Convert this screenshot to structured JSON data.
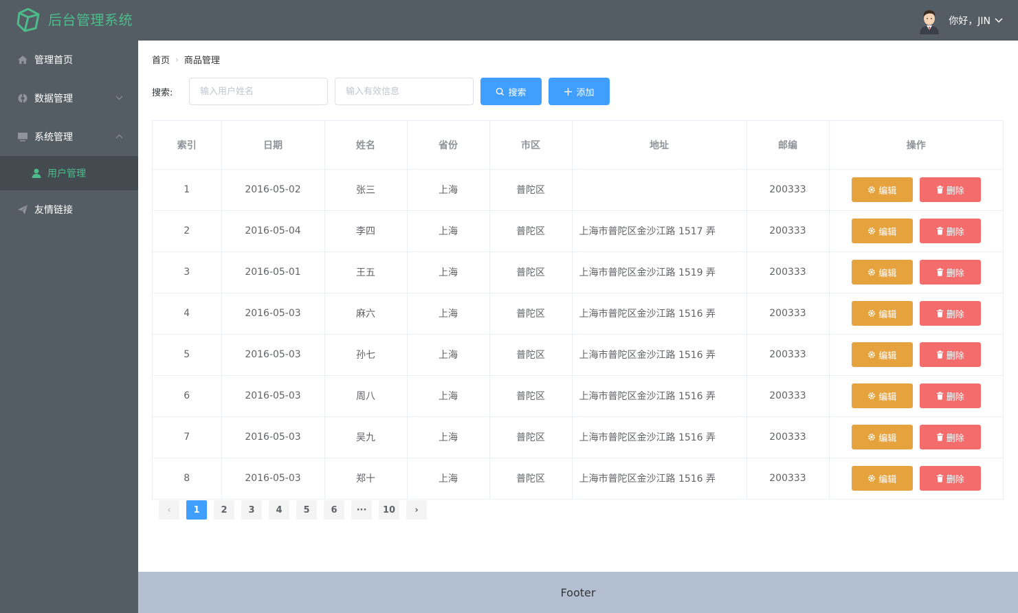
{
  "header": {
    "title": "后台管理系统",
    "greeting": "你好，JIN"
  },
  "sidebar": {
    "items": [
      {
        "label": "管理首页",
        "icon": "home-icon"
      },
      {
        "label": "数据管理",
        "icon": "data-icon"
      },
      {
        "label": "系统管理",
        "icon": "monitor-icon"
      },
      {
        "label": "用户管理",
        "icon": "user-icon"
      },
      {
        "label": "友情链接",
        "icon": "send-icon"
      }
    ]
  },
  "breadcrumb": {
    "home": "首页",
    "current": "商品管理"
  },
  "search": {
    "label": "搜索:",
    "name_placeholder": "输入用户姓名",
    "info_placeholder": "输入有效信息",
    "search_label": "搜索",
    "add_label": "添加"
  },
  "table": {
    "columns": [
      "索引",
      "日期",
      "姓名",
      "省份",
      "市区",
      "地址",
      "邮编",
      "操作"
    ],
    "edit_label": "编辑",
    "delete_label": "删除",
    "rows": [
      {
        "index": "1",
        "date": "2016-05-02",
        "name": "张三",
        "province": "上海",
        "city": "普陀区",
        "address": "",
        "zip": "200333"
      },
      {
        "index": "2",
        "date": "2016-05-04",
        "name": "李四",
        "province": "上海",
        "city": "普陀区",
        "address": "上海市普陀区金沙江路 1517 弄",
        "zip": "200333"
      },
      {
        "index": "3",
        "date": "2016-05-01",
        "name": "王五",
        "province": "上海",
        "city": "普陀区",
        "address": "上海市普陀区金沙江路 1519 弄",
        "zip": "200333"
      },
      {
        "index": "4",
        "date": "2016-05-03",
        "name": "麻六",
        "province": "上海",
        "city": "普陀区",
        "address": "上海市普陀区金沙江路 1516 弄",
        "zip": "200333"
      },
      {
        "index": "5",
        "date": "2016-05-03",
        "name": "孙七",
        "province": "上海",
        "city": "普陀区",
        "address": "上海市普陀区金沙江路 1516 弄",
        "zip": "200333"
      },
      {
        "index": "6",
        "date": "2016-05-03",
        "name": "周八",
        "province": "上海",
        "city": "普陀区",
        "address": "上海市普陀区金沙江路 1516 弄",
        "zip": "200333"
      },
      {
        "index": "7",
        "date": "2016-05-03",
        "name": "吴九",
        "province": "上海",
        "city": "普陀区",
        "address": "上海市普陀区金沙江路 1516 弄",
        "zip": "200333"
      },
      {
        "index": "8",
        "date": "2016-05-03",
        "name": "郑十",
        "province": "上海",
        "city": "普陀区",
        "address": "上海市普陀区金沙江路 1516 弄",
        "zip": "200333"
      }
    ]
  },
  "pagination": {
    "pages": [
      "1",
      "2",
      "3",
      "4",
      "5",
      "6",
      "···",
      "10"
    ],
    "current": "1",
    "prev": "‹",
    "next": "›"
  },
  "footer": {
    "text": "Footer"
  },
  "colors": {
    "accent": "#409eff",
    "brand_green": "#4cbd8a",
    "sidebar_bg": "#545c64",
    "edit": "#e6a23c",
    "delete": "#f56c6c",
    "footer_bg": "#b3c0d1"
  }
}
